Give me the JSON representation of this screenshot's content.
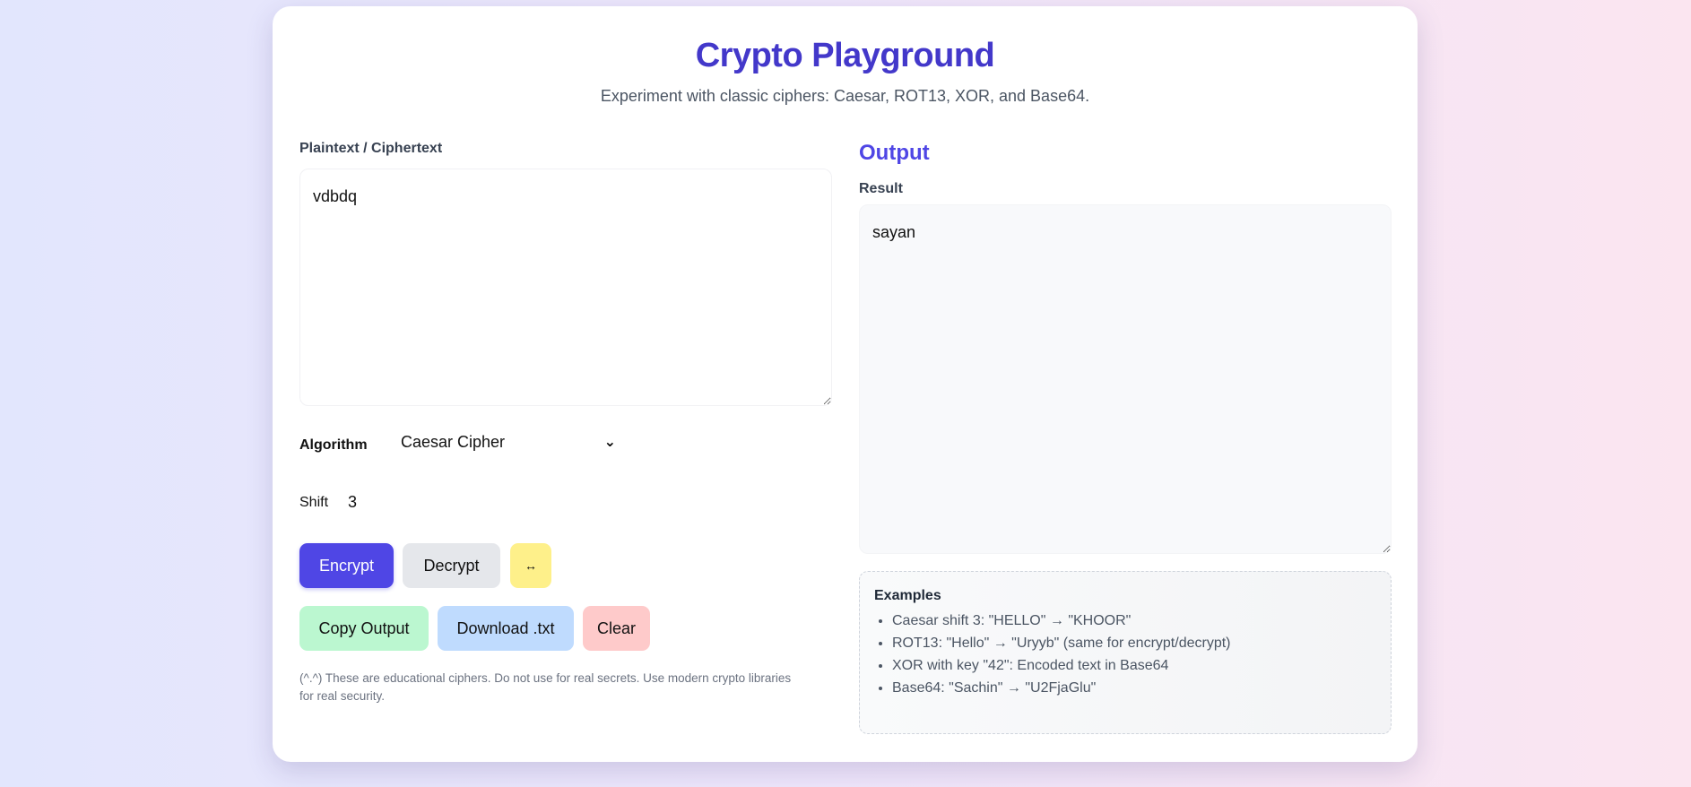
{
  "header": {
    "title": "Crypto Playground",
    "subtitle": "Experiment with classic ciphers: Caesar, ROT13, XOR, and Base64."
  },
  "input": {
    "label": "Plaintext / Ciphertext",
    "value": "vdbdq"
  },
  "algorithm": {
    "label": "Algorithm",
    "selected": "Caesar Cipher"
  },
  "shift": {
    "label": "Shift",
    "value": "3"
  },
  "buttons": {
    "encrypt": "Encrypt",
    "decrypt": "Decrypt",
    "swap": "↔",
    "copy": "Copy Output",
    "download": "Download .txt",
    "clear": "Clear"
  },
  "note": "(^.^) These are educational ciphers. Do not use for real secrets. Use modern crypto libraries for real security.",
  "output": {
    "heading": "Output",
    "label": "Result",
    "value": "sayan"
  },
  "examples": {
    "title": "Examples",
    "items": [
      "Caesar shift 3: \"HELLO\" → \"KHOOR\"",
      "ROT13: \"Hello\" → \"Uryyb\" (same for encrypt/decrypt)",
      "XOR with key \"42\": Encoded text in Base64",
      "Base64: \"Sachin\" → \"U2FjaGlu\""
    ]
  },
  "colors": {
    "primary": "#4f46e5",
    "title": "#4338ca",
    "decrypt": "#e5e7eb",
    "swap": "#fef08a",
    "copy": "#bbf7d0",
    "download": "#bfdbfe",
    "clear": "#fecaca"
  }
}
